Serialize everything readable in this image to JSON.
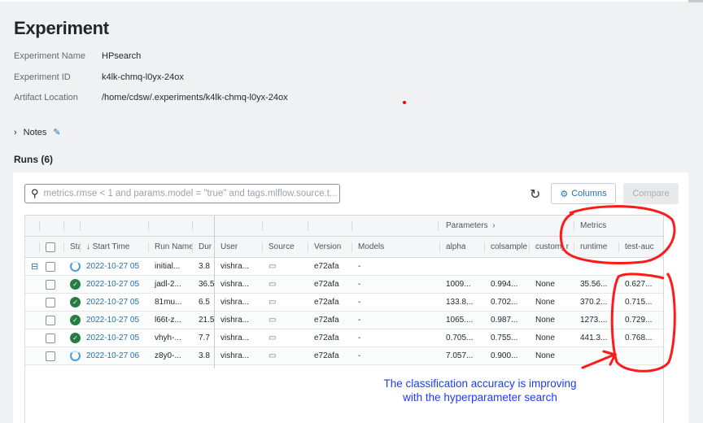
{
  "header": {
    "title": "Experiment"
  },
  "meta": [
    {
      "label": "Experiment Name",
      "value": "HPsearch"
    },
    {
      "label": "Experiment ID",
      "value": "k4lk-chmq-l0yx-24ox"
    },
    {
      "label": "Artifact Location",
      "value": "/home/cdsw/.experiments/k4lk-chmq-l0yx-24ox"
    }
  ],
  "notes": {
    "label": "Notes"
  },
  "runs": {
    "title": "Runs (6)",
    "search_placeholder": "metrics.rmse < 1 and params.model = \"true\" and tags.mlflow.source.t...",
    "columns_label": "Columns",
    "compare_label": "Compare",
    "groups": {
      "parameters": "Parameters",
      "metrics": "Metrics"
    },
    "headers": [
      "Stat",
      "↓ Start Time",
      "Run Name",
      "Dur",
      "User",
      "Source",
      "Version",
      "Models",
      "alpha",
      "colsample",
      "custom_r",
      "runtime",
      "test-auc"
    ],
    "rows": [
      {
        "status": "running",
        "start": "2022-10-27 05",
        "name": "initial...",
        "dur": "3.8",
        "user": "vishra...",
        "version": "e72afa",
        "models": "-",
        "alpha": "",
        "colsample": "",
        "custom": "",
        "runtime": "",
        "auc": "",
        "expand": "true"
      },
      {
        "status": "finished",
        "start": "2022-10-27 05",
        "name": "jadl-2...",
        "dur": "36.5",
        "user": "vishra...",
        "version": "e72afa",
        "models": "-",
        "alpha": "1009...",
        "colsample": "0.994...",
        "custom": "None",
        "runtime": "35.56...",
        "auc": "0.627..."
      },
      {
        "status": "finished",
        "start": "2022-10-27 05",
        "name": "81mu...",
        "dur": "6.5",
        "user": "vishra...",
        "version": "e72afa",
        "models": "-",
        "alpha": "133.8...",
        "colsample": "0.702...",
        "custom": "None",
        "runtime": "370.2...",
        "auc": "0.715..."
      },
      {
        "status": "finished",
        "start": "2022-10-27 05",
        "name": "l66t-z...",
        "dur": "21.5",
        "user": "vishra...",
        "version": "e72afa",
        "models": "-",
        "alpha": "1065....",
        "colsample": "0.987...",
        "custom": "None",
        "runtime": "1273....",
        "auc": "0.729..."
      },
      {
        "status": "finished",
        "start": "2022-10-27 05",
        "name": "vhyh-...",
        "dur": "7.7",
        "user": "vishra...",
        "version": "e72afa",
        "models": "-",
        "alpha": "0.705...",
        "colsample": "0.755...",
        "custom": "None",
        "runtime": "441.3...",
        "auc": "0.768..."
      },
      {
        "status": "running",
        "start": "2022-10-27 06",
        "name": "z8y0-...",
        "dur": "3.8",
        "user": "vishra...",
        "version": "e72afa",
        "models": "-",
        "alpha": "7.057...",
        "colsample": "0.900...",
        "custom": "None",
        "runtime": "",
        "auc": ""
      }
    ]
  },
  "annotation": {
    "line1": "The classification accuracy is improving",
    "line2": "with the hyperparameter search",
    "color": "#ff1a1a"
  }
}
